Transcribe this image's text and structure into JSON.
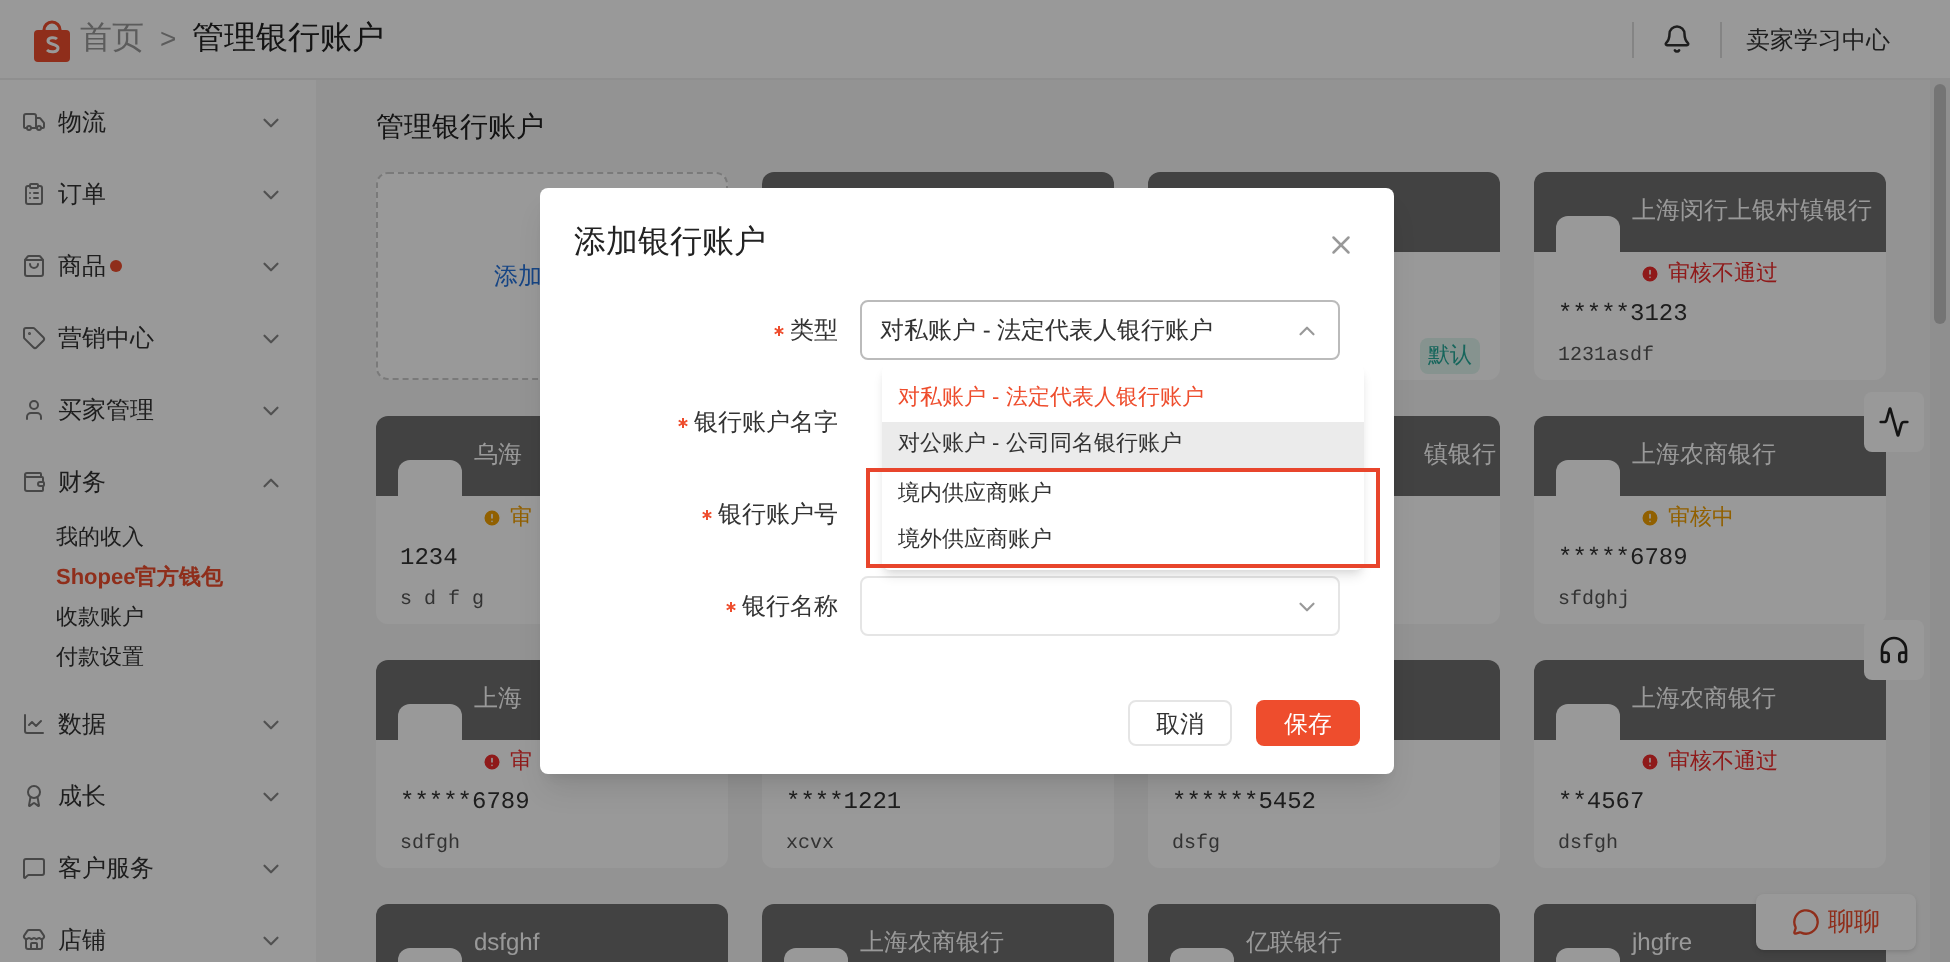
{
  "topbar": {
    "breadcrumb": [
      {
        "label": "首页",
        "selected": false
      },
      {
        "label": "管理银行账户",
        "selected": true
      }
    ],
    "separator": ">",
    "learning_center": "卖家学习中心"
  },
  "sidebar": {
    "items": [
      {
        "label": "物流",
        "expanded": false,
        "badge": false
      },
      {
        "label": "订单",
        "expanded": false,
        "badge": false
      },
      {
        "label": "商品",
        "expanded": false,
        "badge": true
      },
      {
        "label": "营销中心",
        "expanded": false,
        "badge": false
      },
      {
        "label": "买家管理",
        "expanded": false,
        "badge": false
      },
      {
        "label": "财务",
        "expanded": true,
        "badge": false,
        "children": [
          {
            "label": "我的收入",
            "selected": false
          },
          {
            "label": "Shopee官方钱包",
            "selected": true
          },
          {
            "label": "收款账户",
            "selected": false
          },
          {
            "label": "付款设置",
            "selected": false
          }
        ]
      },
      {
        "label": "数据",
        "expanded": false,
        "badge": false
      },
      {
        "label": "成长",
        "expanded": false,
        "badge": false
      },
      {
        "label": "客户服务",
        "expanded": false,
        "badge": false
      },
      {
        "label": "店铺",
        "expanded": false,
        "badge": false
      }
    ]
  },
  "page_title": "管理银行账户",
  "cards": [
    {
      "kind": "add",
      "label": "添加"
    },
    {
      "kind": "account"
    },
    {
      "kind": "account",
      "tag": "默认"
    },
    {
      "kind": "account",
      "title": "上海闵行上银村镇银行",
      "status": {
        "kind": "rejected",
        "text": "审核不通过"
      },
      "number": "*****3123",
      "note": "1231asdf"
    },
    {
      "kind": "account",
      "title": "乌海",
      "status": {
        "kind": "pending",
        "text": "审"
      },
      "number": "1234",
      "note": "s d f g"
    },
    {
      "kind": "account"
    },
    {
      "kind": "clipped",
      "title": "镇银行"
    },
    {
      "kind": "account",
      "title": "上海农商银行",
      "status": {
        "kind": "pending",
        "text": "审核中"
      },
      "number": "*****6789",
      "note": "sfdghj"
    },
    {
      "kind": "account",
      "title": "上海",
      "status": {
        "kind": "rejected",
        "text": "审"
      },
      "number": "*****6789",
      "note": "sdfgh"
    },
    {
      "kind": "account",
      "number": "****1221",
      "note": "xcvx"
    },
    {
      "kind": "account",
      "number": "******5452",
      "note": "dsfg"
    },
    {
      "kind": "account",
      "title": "上海农商银行",
      "status": {
        "kind": "rejected",
        "text": "审核不通过"
      },
      "number": "**4567",
      "note": "dsfgh"
    },
    {
      "kind": "account",
      "title": "dsfghf"
    },
    {
      "kind": "account",
      "title": "上海农商银行"
    },
    {
      "kind": "account",
      "title": "亿联银行"
    },
    {
      "kind": "account",
      "title": "jhgfre"
    }
  ],
  "chat": {
    "label": "聊聊"
  },
  "modal": {
    "title": "添加银行账户",
    "fields": [
      {
        "label": "类型",
        "required": true,
        "kind": "select",
        "value": "对私账户 - 法定代表人银行账户",
        "open": true
      },
      {
        "label": "银行账户名字",
        "required": true,
        "kind": "covered"
      },
      {
        "label": "银行账户号",
        "required": true,
        "kind": "covered"
      },
      {
        "label": "银行名称",
        "required": true,
        "kind": "select",
        "open": false
      }
    ],
    "dropdown": [
      {
        "label": "对私账户 - 法定代表人银行账户",
        "selected": true,
        "hovered": false,
        "highlighted": false
      },
      {
        "label": "对公账户 - 公司同名银行账户",
        "selected": false,
        "hovered": true,
        "highlighted": false
      },
      {
        "label": "境内供应商账户",
        "selected": false,
        "hovered": false,
        "highlighted": true
      },
      {
        "label": "境外供应商账户",
        "selected": false,
        "hovered": false,
        "highlighted": true
      }
    ],
    "buttons": [
      {
        "label": "取消",
        "kind": "secondary"
      },
      {
        "label": "保存",
        "kind": "primary"
      }
    ]
  }
}
